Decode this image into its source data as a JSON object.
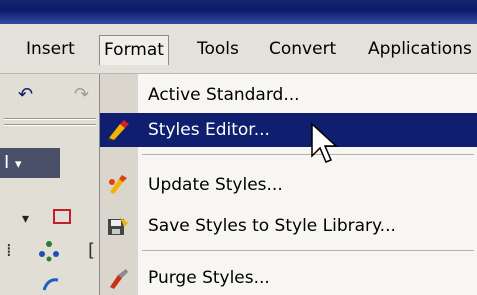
{
  "menubar": {
    "items": [
      {
        "label": "Insert"
      },
      {
        "label": "Format"
      },
      {
        "label": "Tools"
      },
      {
        "label": "Convert"
      },
      {
        "label": "Applications"
      }
    ]
  },
  "format_menu": {
    "active_standard": "Active Standard...",
    "styles_editor": "Styles Editor...",
    "update_styles": "Update Styles...",
    "save_styles": "Save Styles to Style Library...",
    "purge_styles": "Purge Styles..."
  },
  "colors": {
    "highlight": "#0f1e6e",
    "menu_bg": "#f7f6f3",
    "icon_strip": "#dad6ce"
  }
}
